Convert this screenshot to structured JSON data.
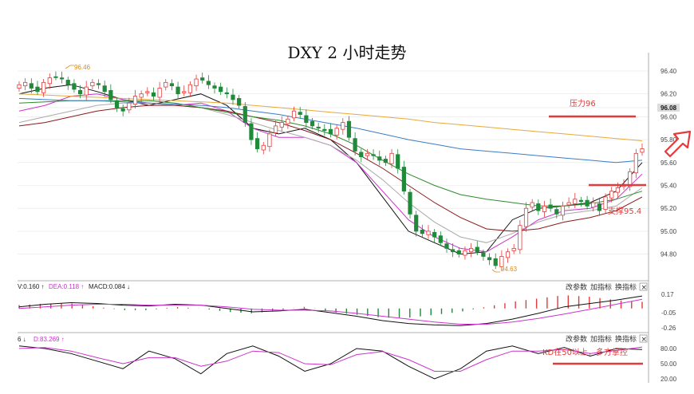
{
  "title": "DXY 2 小时走势",
  "chart_data": [
    {
      "type": "candlestick",
      "title": "DXY 2 小时走势",
      "ylim": [
        94.63,
        96.5
      ],
      "y_ticks": [
        "96.40",
        "96.20",
        "96.08",
        "96.00",
        "95.80",
        "95.60",
        "95.40",
        "95.20",
        "95.00",
        "94.80"
      ],
      "highlight_tick": "96.08",
      "high_label": "96.46",
      "low_label": "94.63",
      "close_series": [
        96.28,
        96.3,
        96.25,
        96.22,
        96.3,
        96.34,
        96.35,
        96.33,
        96.28,
        96.24,
        96.2,
        96.26,
        96.3,
        96.28,
        96.22,
        96.15,
        96.08,
        96.05,
        96.12,
        96.18,
        96.2,
        96.22,
        96.18,
        96.25,
        96.3,
        96.27,
        96.2,
        96.22,
        96.28,
        96.33,
        96.32,
        96.28,
        96.25,
        96.22,
        96.2,
        96.15,
        96.1,
        95.95,
        95.8,
        95.72,
        95.75,
        95.85,
        95.92,
        95.95,
        95.98,
        96.05,
        96.02,
        95.95,
        95.92,
        95.9,
        95.88,
        95.85,
        95.9,
        95.95,
        95.82,
        95.7,
        95.65,
        95.68,
        95.66,
        95.62,
        95.6,
        95.68,
        95.55,
        95.35,
        95.15,
        95.0,
        94.98,
        95.0,
        94.95,
        94.9,
        94.85,
        94.82,
        94.8,
        94.83,
        94.85,
        94.82,
        94.78,
        94.75,
        94.7,
        94.78,
        94.82,
        94.85,
        95.05,
        95.2,
        95.25,
        95.18,
        95.22,
        95.2,
        95.15,
        95.22,
        95.25,
        95.28,
        95.26,
        95.22,
        95.25,
        95.18,
        95.3,
        95.35,
        95.38,
        95.4,
        95.52,
        95.68,
        95.72
      ],
      "moving_averages": [
        {
          "color": "#111111",
          "values": [
            96.2,
            96.25,
            96.28,
            96.22,
            96.15,
            96.1,
            96.15,
            96.2,
            96.1,
            95.9,
            95.85,
            95.9,
            95.8,
            95.6,
            95.3,
            95.0,
            94.9,
            94.8,
            94.82,
            95.1,
            95.2,
            95.22,
            95.25,
            95.35,
            95.6
          ]
        },
        {
          "color": "#cc33cc",
          "values": [
            96.05,
            96.1,
            96.18,
            96.2,
            96.15,
            96.12,
            96.1,
            96.12,
            96.05,
            95.9,
            95.82,
            95.82,
            95.75,
            95.6,
            95.35,
            95.1,
            94.95,
            94.85,
            94.82,
            94.95,
            95.1,
            95.18,
            95.2,
            95.28,
            95.5
          ]
        },
        {
          "color": "#aaaaaa",
          "values": [
            95.95,
            96.0,
            96.05,
            96.1,
            96.12,
            96.12,
            96.1,
            96.08,
            96.02,
            95.95,
            95.88,
            95.82,
            95.75,
            95.62,
            95.45,
            95.25,
            95.08,
            94.95,
            94.9,
            94.98,
            95.08,
            95.15,
            95.18,
            95.22,
            95.38
          ]
        },
        {
          "color": "#8b1a1a",
          "values": [
            95.92,
            95.95,
            96.0,
            96.05,
            96.08,
            96.1,
            96.1,
            96.08,
            96.05,
            96.0,
            95.95,
            95.88,
            95.8,
            95.68,
            95.55,
            95.4,
            95.25,
            95.12,
            95.02,
            95.0,
            95.02,
            95.08,
            95.12,
            95.18,
            95.3
          ]
        },
        {
          "color": "#2e8b2e",
          "values": [
            96.12,
            96.13,
            96.14,
            96.14,
            96.14,
            96.14,
            96.12,
            96.08,
            96.04,
            96.0,
            95.97,
            95.92,
            95.85,
            95.75,
            95.62,
            95.5,
            95.4,
            95.32,
            95.28,
            95.25,
            95.22,
            95.22,
            95.24,
            95.28,
            95.35
          ]
        },
        {
          "color": "#3a7dc4",
          "values": [
            96.16,
            96.15,
            96.14,
            96.14,
            96.13,
            96.12,
            96.11,
            96.1,
            96.08,
            96.05,
            96.02,
            95.98,
            95.94,
            95.9,
            95.85,
            95.8,
            95.76,
            95.72,
            95.7,
            95.68,
            95.66,
            95.64,
            95.62,
            95.6,
            95.62
          ]
        },
        {
          "color": "#e8a83a",
          "values": [
            96.2,
            96.19,
            96.18,
            96.17,
            96.16,
            96.15,
            96.14,
            96.13,
            96.12,
            96.1,
            96.08,
            96.06,
            96.04,
            96.02,
            96.0,
            95.98,
            95.95,
            95.93,
            95.91,
            95.89,
            95.87,
            95.85,
            95.83,
            95.81,
            95.79
          ]
        }
      ]
    },
    {
      "type": "macd",
      "legend": [
        "V:0.160 ↑",
        "DEA:0.118 ↑",
        "MACD:0.084 ↓"
      ],
      "y_ticks": [
        "0.17",
        "-0.05",
        "-0.26"
      ],
      "ylim": [
        -0.28,
        0.2
      ],
      "dif": [
        0.02,
        0.05,
        0.07,
        0.06,
        0.04,
        0.03,
        0.05,
        0.04,
        0.0,
        -0.04,
        -0.03,
        -0.01,
        -0.05,
        -0.1,
        -0.16,
        -0.2,
        -0.22,
        -0.23,
        -0.2,
        -0.14,
        -0.06,
        0.02,
        0.06,
        0.1,
        0.15
      ],
      "dea": [
        0.0,
        0.02,
        0.04,
        0.05,
        0.05,
        0.04,
        0.04,
        0.04,
        0.02,
        -0.01,
        -0.02,
        -0.02,
        -0.03,
        -0.06,
        -0.1,
        -0.14,
        -0.18,
        -0.21,
        -0.21,
        -0.18,
        -0.13,
        -0.07,
        -0.01,
        0.05,
        0.11
      ],
      "hist": [
        0.04,
        0.06,
        0.06,
        0.02,
        -0.02,
        -0.02,
        0.02,
        0.0,
        -0.04,
        -0.06,
        -0.02,
        0.02,
        -0.04,
        -0.08,
        -0.12,
        -0.12,
        -0.08,
        -0.04,
        0.02,
        0.08,
        0.12,
        0.16,
        0.14,
        0.1,
        0.08
      ]
    },
    {
      "type": "kdj",
      "legend": [
        "6 ↓",
        "D:83.269 ↑"
      ],
      "y_ticks": [
        "80.00",
        "50.00",
        "20.00"
      ],
      "ylim": [
        0,
        100
      ],
      "k": [
        85,
        80,
        70,
        55,
        40,
        75,
        60,
        30,
        70,
        85,
        65,
        35,
        50,
        80,
        75,
        45,
        20,
        40,
        75,
        85,
        70,
        82,
        65,
        80,
        78
      ],
      "d": [
        80,
        82,
        75,
        62,
        50,
        62,
        62,
        45,
        55,
        75,
        72,
        50,
        48,
        68,
        74,
        58,
        35,
        35,
        58,
        75,
        75,
        78,
        70,
        76,
        83
      ]
    }
  ],
  "buttons": {
    "param": "改参数",
    "add": "加指标",
    "swap": "换指标",
    "close": "×"
  },
  "annotations": {
    "resistance": "压力96",
    "support": "支撑95.4",
    "kd": "KD在50以上，多方掌控"
  },
  "colors": {
    "up": "#e33b3b",
    "down": "#1f8a3a",
    "accent": "#e33b3b"
  }
}
